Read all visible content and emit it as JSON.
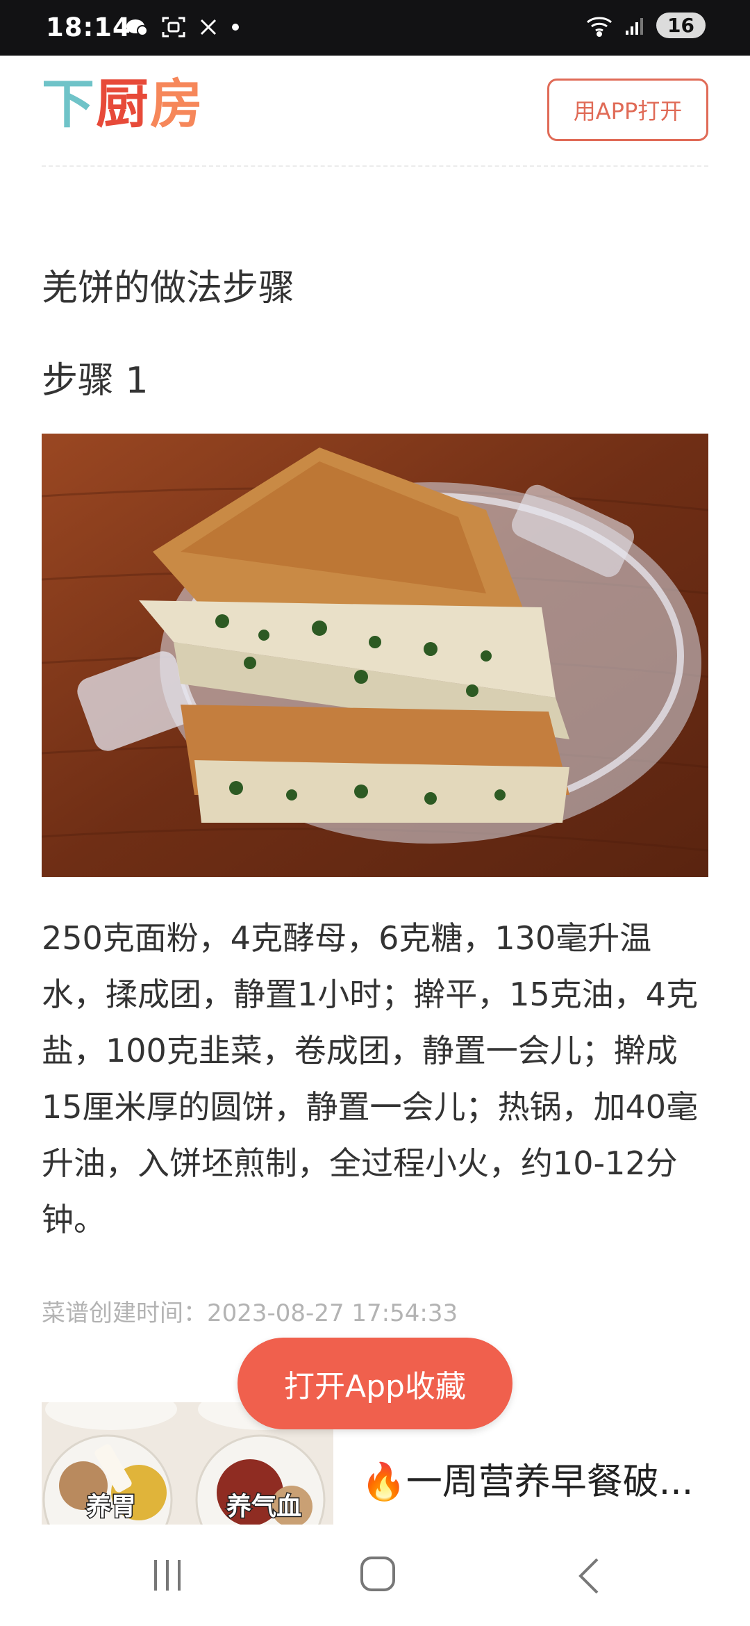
{
  "status": {
    "time": "18:14",
    "battery": "16"
  },
  "header": {
    "logo_parts": [
      "下",
      "厨",
      "房"
    ],
    "open_app_label": "用APP打开"
  },
  "recipe": {
    "title": "羌饼的做法步骤",
    "step_title": "步骤 1",
    "step_description": "250克面粉，4克酵母，6克糖，130毫升温水，揉成团，静置1小时；擀平，15克油，4克盐，100克韭菜，卷成团，静置一会儿；擀成15厘米厚的圆饼，静置一会儿；热锅，加40毫升油，入饼坯煎制，全过程小火，约10-12分钟。",
    "created_label": "菜谱创建时间：",
    "created_time": "2023-08-27 17:54:33"
  },
  "fab": {
    "label": "打开App收藏"
  },
  "recommend": {
    "thumb_labels": [
      "养胃",
      "养气血"
    ],
    "title": "一周营养早餐破..."
  },
  "colors": {
    "accent": "#f0604d",
    "logo_teal": "#6fc3c8",
    "logo_red": "#e74a39",
    "logo_orange": "#f6875a"
  }
}
